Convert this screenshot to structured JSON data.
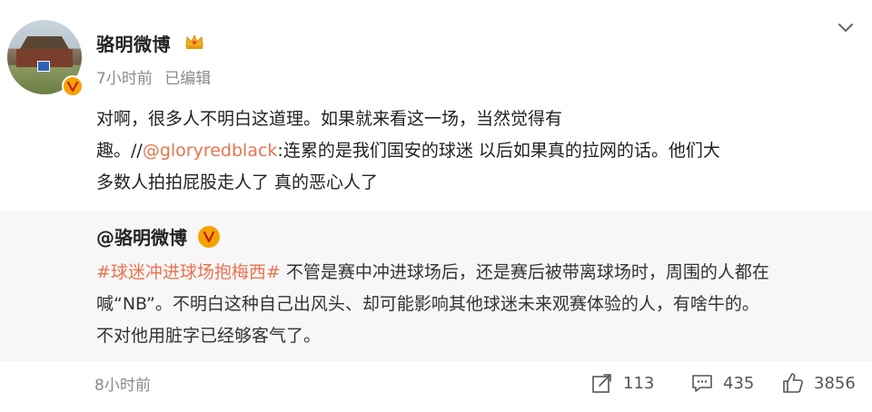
{
  "post": {
    "username": "骆明微博",
    "meta": {
      "time": "7小时前",
      "edited": "已编辑"
    },
    "text_lines": [
      "对啊，很多人不明白这道理。如果就来看这一场，当然觉得有",
      {
        "prefix": "趣。//",
        "mention": "@gloryredblack",
        "suffix": ":连累的是我们国安的球迷 以后如果真的拉网的话。他们大"
      },
      "多数人拍拍屁股走人了 真的恶心人了"
    ]
  },
  "quote": {
    "author": "@骆明微博",
    "lines": [
      {
        "hashtag": "#球迷冲进球场抱梅西#",
        "text": " 不管是赛中冲进球场后，还是赛后被带离球场时，周围的人都在"
      },
      "喊“NB”。不明白这种自己出风头、却可能影响其他球迷未来观赛体验的人，有啥牛的。",
      "不对他用脏字已经够客气了。"
    ]
  },
  "footer": {
    "timestamp": "8小时前",
    "repost_count": "113",
    "comment_count": "435",
    "like_count": "3856"
  },
  "icons": {
    "verified": "verified-badge-icon",
    "crown": "crown-icon",
    "menu": "chevron-down-icon",
    "repost": "share-icon",
    "comment": "comment-icon",
    "like": "thumbs-up-icon"
  },
  "colors": {
    "link": "#eb7350",
    "badge": "#f5a300",
    "quote_bg": "#f7f7f7",
    "muted": "#8a8a8a"
  }
}
